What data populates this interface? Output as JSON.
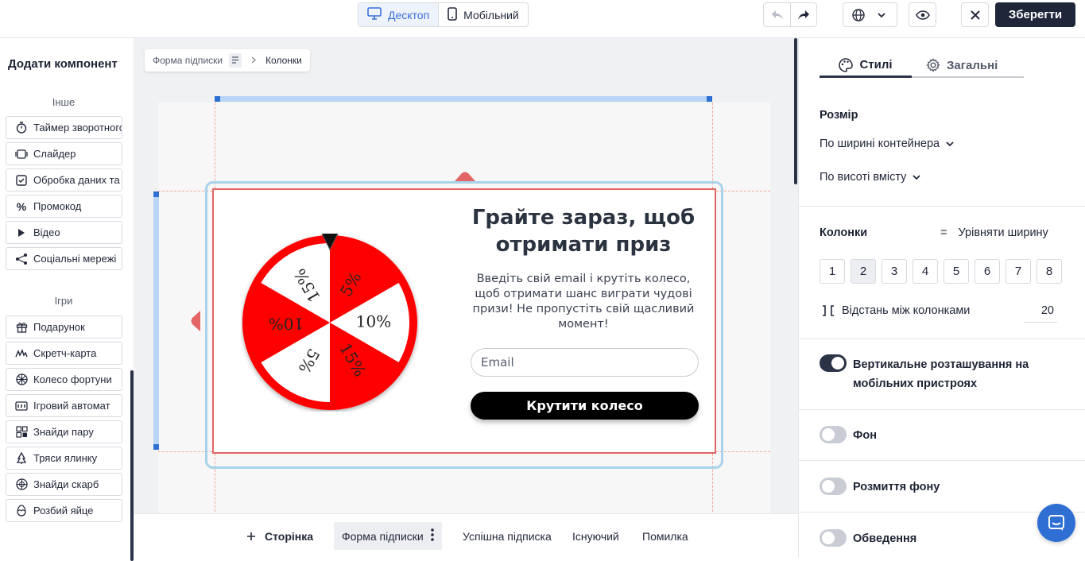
{
  "toolbar": {
    "view_desktop": "Десктоп",
    "view_mobile": "Мобільний",
    "save_label": "Зберегти"
  },
  "left_panel": {
    "title": "Додати компонент",
    "section_other": "Інше",
    "other_items": [
      {
        "label": "Таймер зворотного відліку",
        "icon": "timer-icon"
      },
      {
        "label": "Слайдер",
        "icon": "slider-icon"
      },
      {
        "label": "Обробка даних та",
        "icon": "checkbox-icon"
      },
      {
        "label": "Промокод",
        "icon": "percent-icon"
      },
      {
        "label": "Відео",
        "icon": "play-icon"
      },
      {
        "label": "Соціальні мережі",
        "icon": "share-icon"
      }
    ],
    "section_games": "Ігри",
    "game_items": [
      {
        "label": "Подарунок",
        "icon": "gift-icon"
      },
      {
        "label": "Скретч-карта",
        "icon": "scratch-icon"
      },
      {
        "label": "Колесо фортуни",
        "icon": "wheel-icon"
      },
      {
        "label": "Ігровий автомат",
        "icon": "slot-icon"
      },
      {
        "label": "Знайди пару",
        "icon": "pairs-icon"
      },
      {
        "label": "Тряси ялинку",
        "icon": "tree-icon"
      },
      {
        "label": "Знайди скарб",
        "icon": "treasure-icon"
      },
      {
        "label": "Розбий яйце",
        "icon": "egg-icon"
      }
    ]
  },
  "breadcrumb": {
    "parent": "Форма підписки",
    "current": "Колонки"
  },
  "popup": {
    "title": "Грайте зараз, щоб отримати приз",
    "description": "Введіть свій email і крутіть колесо, щоб отримати шанс виграти чудові призи! Не пропустіть свій щасливий момент!",
    "email_placeholder": "Email",
    "button_label": "Крутити колесо",
    "wheel_segments": [
      "5%",
      "10%",
      "15%",
      "5%",
      "10%",
      "15%"
    ],
    "wheel_colors": {
      "red": "#ff0000",
      "white": "#ffffff"
    }
  },
  "bottom_bar": {
    "add_page": "Сторінка",
    "pages": [
      "Форма підписки",
      "Успішна підписка",
      "Існуючий",
      "Помилка"
    ]
  },
  "right_panel": {
    "tab_styles": "Стилі",
    "tab_general": "Загальні",
    "size_heading": "Розмір",
    "width_option": "По ширині контейнера",
    "height_option": "По висоті вмісту",
    "columns_heading": "Колонки",
    "equalize_label": "Урівняти ширину",
    "column_counts": [
      "1",
      "2",
      "3",
      "4",
      "5",
      "6",
      "7",
      "8"
    ],
    "selected_columns": "2",
    "gap_label": "Відстань між колонками",
    "gap_value": "20",
    "toggles": [
      {
        "label": "Вертикальне розташування на мобільних пристроях",
        "on": true
      },
      {
        "label": "Фон",
        "on": false
      },
      {
        "label": "Розмиття фону",
        "on": false
      },
      {
        "label": "Обведення",
        "on": false
      }
    ]
  },
  "colors": {
    "accent_dark": "#20263a",
    "accent_blue": "#3a6fd8",
    "selection_red": "#e36565",
    "chat_blue": "#2f6fd4"
  }
}
